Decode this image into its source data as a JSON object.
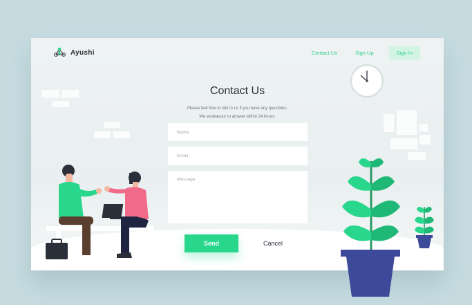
{
  "brand": {
    "name": "Ayushi"
  },
  "nav": {
    "contact": "Contact Us",
    "signup": "Sign Up",
    "signin": "Sign In"
  },
  "page": {
    "title": "Contact Us",
    "subtitle_line1": "Please feel free to talk to us if you have any questions.",
    "subtitle_line2": "We endeavour to answer within 24 hours."
  },
  "form": {
    "name_placeholder": "Name",
    "email_placeholder": "Email",
    "message_placeholder": "Message",
    "send_label": "Send",
    "cancel_label": "Cancel"
  },
  "colors": {
    "accent": "#28d68c",
    "accent_light": "#d2f5e3",
    "text_dark": "#2b2f3a",
    "pot": "#3d4a9a"
  },
  "icons": {
    "logo": "network-nodes-icon",
    "clock": "wall-clock-icon"
  }
}
